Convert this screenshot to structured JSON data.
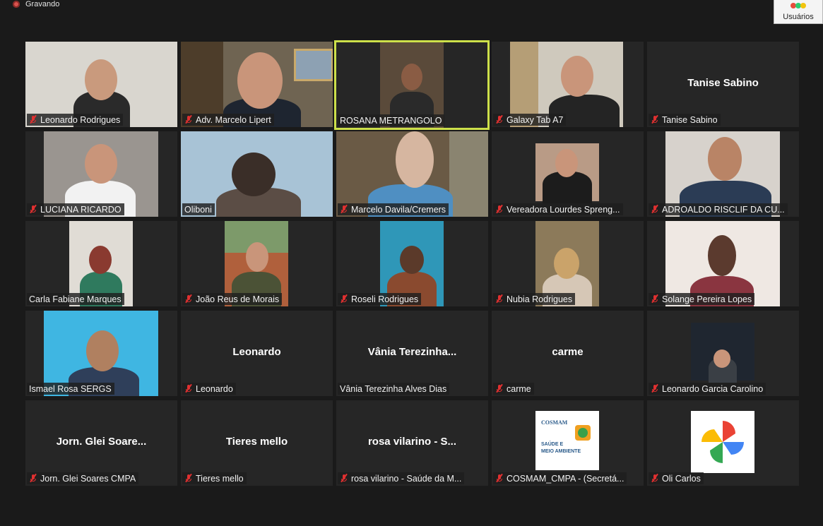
{
  "recording": {
    "label": "Gravando"
  },
  "users_button": {
    "label": "Usuários"
  },
  "colors": {
    "tile_bg": "#262626",
    "active_border": "#cde04a",
    "muted_mic": "#e03030",
    "recording_dot": "#d9534f"
  },
  "tiles": [
    {
      "name": "Leonardo Rodrigues",
      "muted": true
    },
    {
      "name": "Adv. Marcelo Lipert",
      "muted": true
    },
    {
      "name": "ROSANA METRANGOLO",
      "muted": false,
      "active": true
    },
    {
      "name": "Galaxy Tab A7",
      "muted": true
    },
    {
      "name": "Tanise Sabino",
      "muted": true,
      "display": "Tanise Sabino"
    },
    {
      "name": "LUCIANA RICARDO",
      "muted": true
    },
    {
      "name": "Oliboni",
      "muted": false
    },
    {
      "name": "Marcelo Davila/Cremers",
      "muted": true
    },
    {
      "name": "Vereadora Lourdes Spreng...",
      "muted": true
    },
    {
      "name": "ADROALDO RISCLIF DA CU...",
      "muted": true
    },
    {
      "name": "Carla Fabiane Marques",
      "muted": false
    },
    {
      "name": "João Reus de Morais",
      "muted": true
    },
    {
      "name": "Roseli Rodrigues",
      "muted": true
    },
    {
      "name": "Nubia Rodrigues",
      "muted": true
    },
    {
      "name": "Solange Pereira Lopes",
      "muted": true
    },
    {
      "name": "Ismael Rosa SERGS",
      "muted": false
    },
    {
      "name": "Leonardo",
      "muted": true,
      "display": "Leonardo"
    },
    {
      "name": "Vânia Terezinha Alves Dias",
      "muted": false,
      "display": "Vânia Terezinha..."
    },
    {
      "name": "carme",
      "muted": true,
      "display": "carme"
    },
    {
      "name": "Leonardo Garcia Carolino",
      "muted": true
    },
    {
      "name": "Jorn. Glei Soares CMPA",
      "muted": true,
      "display": "Jorn. Glei Soare..."
    },
    {
      "name": "Tieres mello",
      "muted": true,
      "display": "Tieres mello"
    },
    {
      "name": "rosa vilarino - Saúde da M...",
      "muted": true,
      "display": "rosa vilarino - S..."
    },
    {
      "name": "COSMAM_CMPA - (Secretá...",
      "muted": true,
      "logo_lines": [
        "COSMAM",
        "SAÚDE E",
        "MEIO AMBIENTE"
      ]
    },
    {
      "name": "Oli Carlos",
      "muted": true
    }
  ]
}
